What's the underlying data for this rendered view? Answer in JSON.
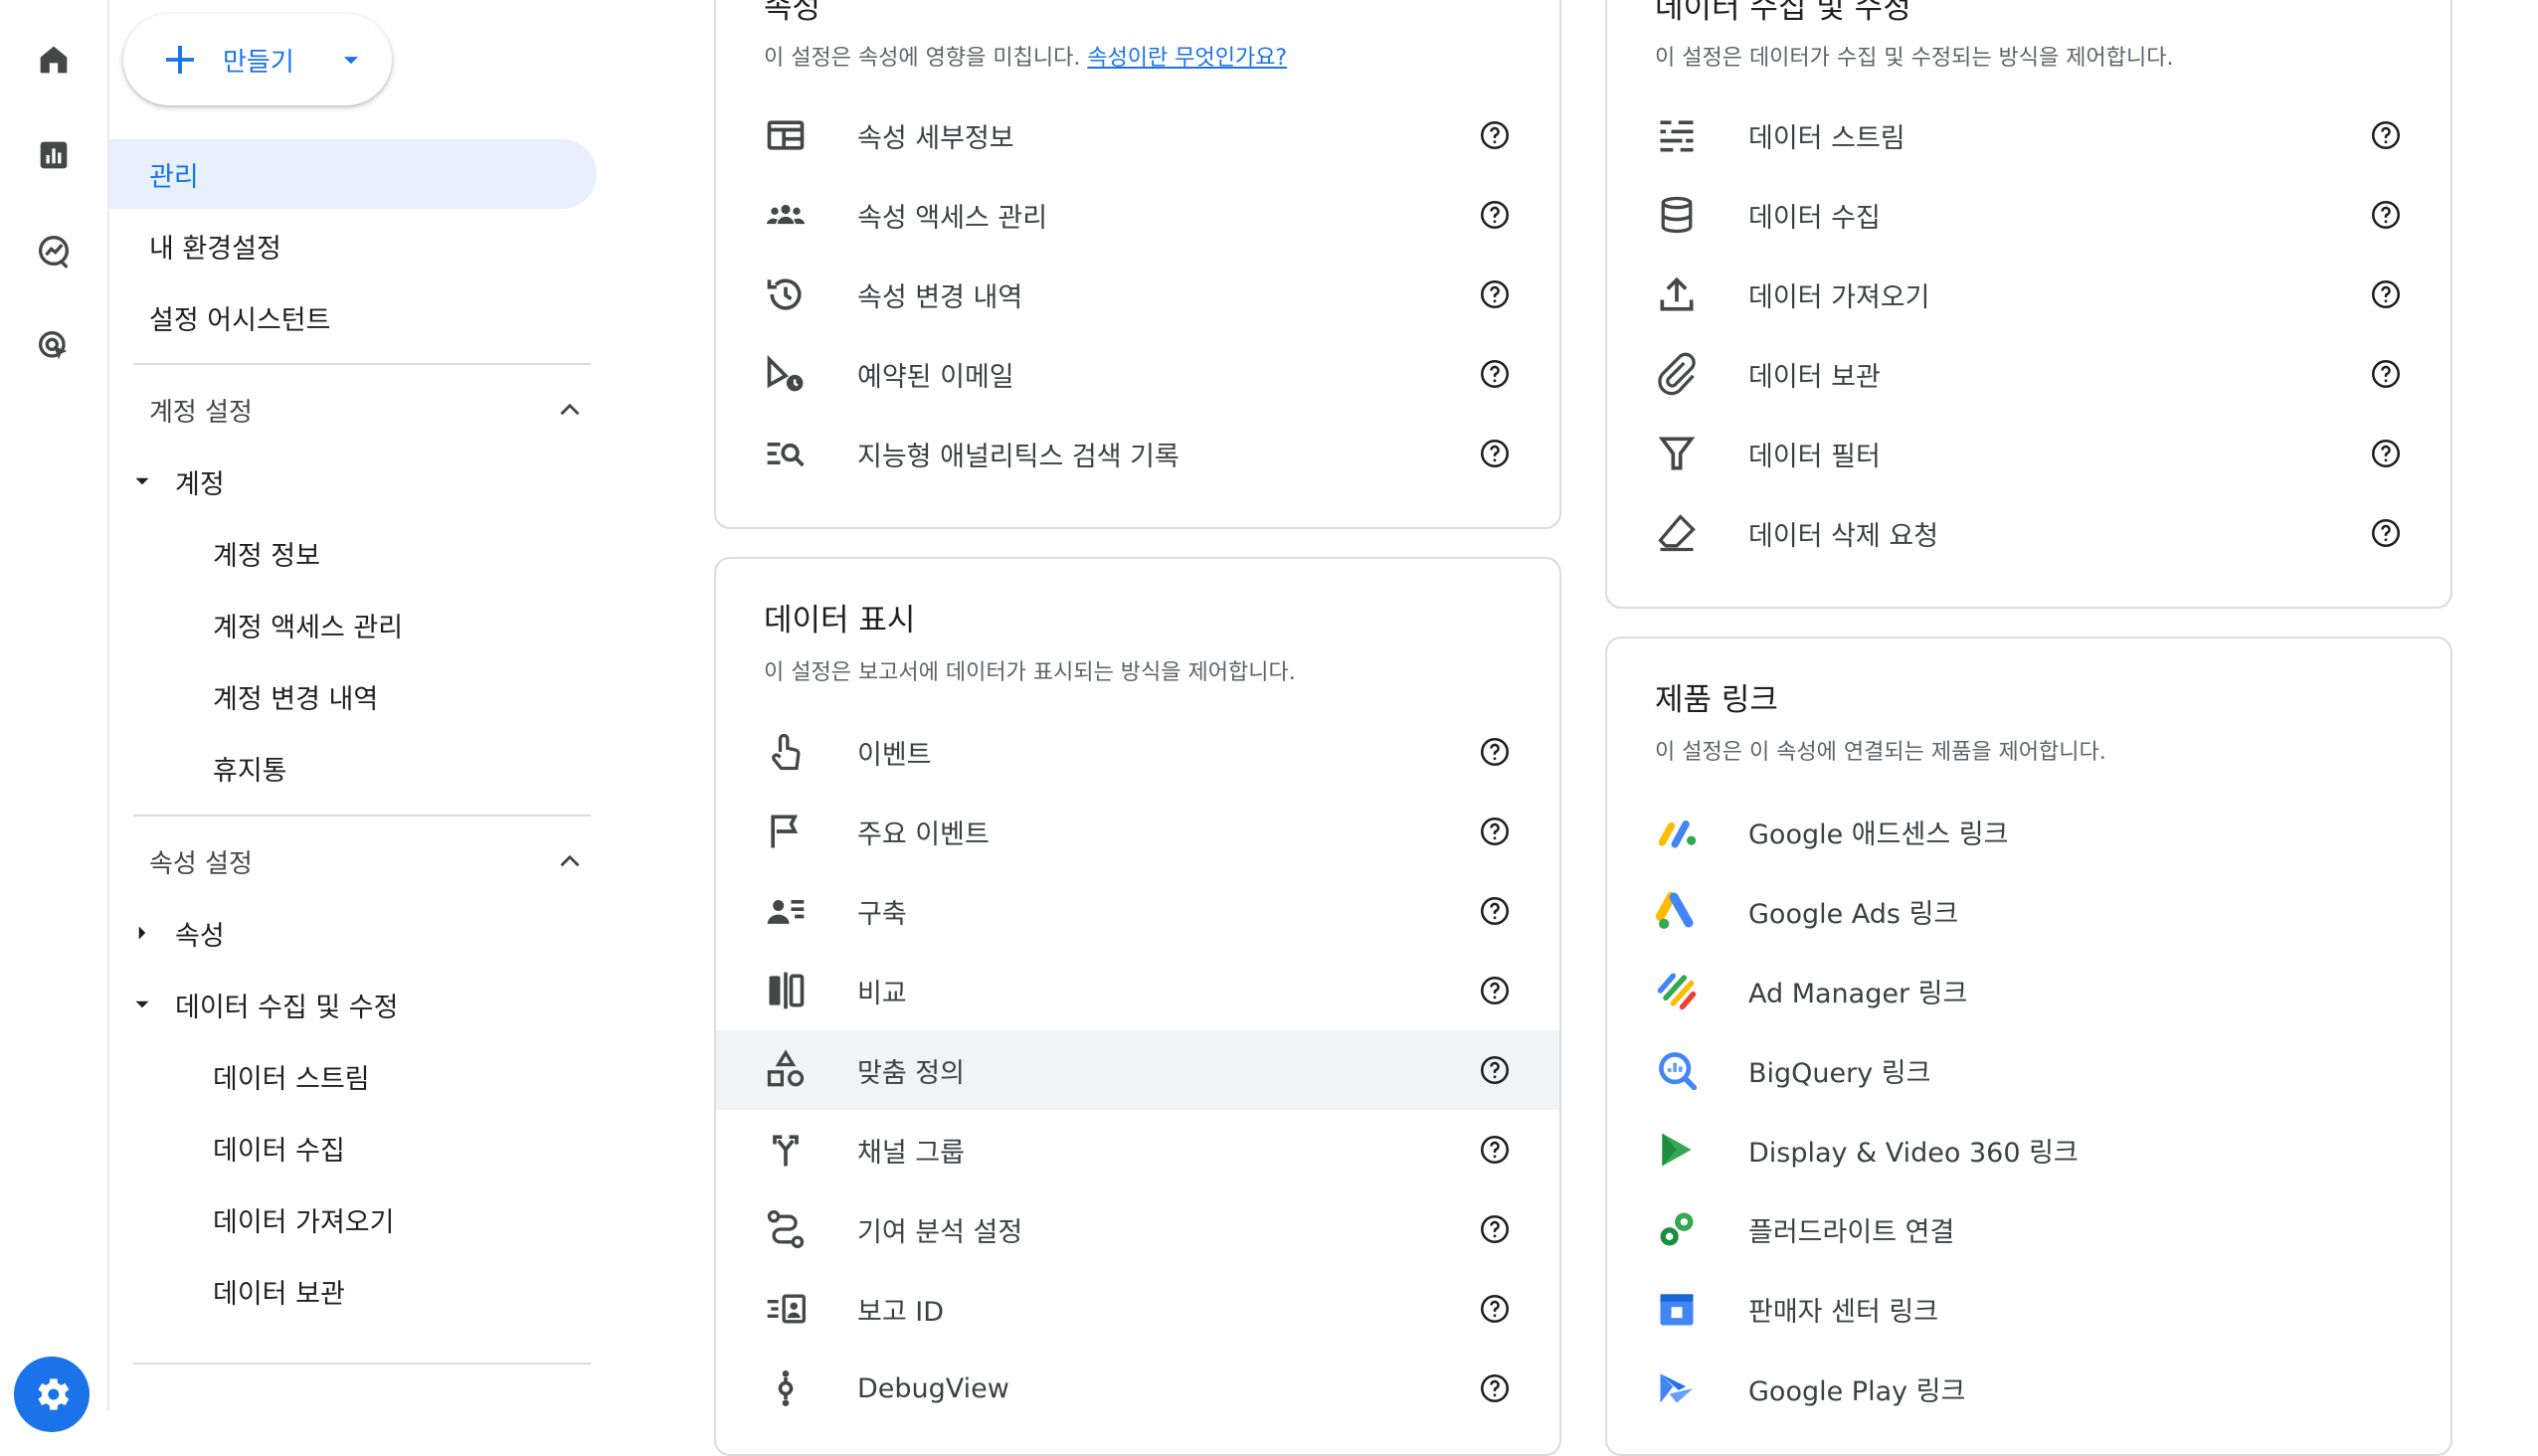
{
  "rail": {
    "items": [
      {
        "name": "home-icon"
      },
      {
        "name": "reports-icon"
      },
      {
        "name": "explore-icon"
      },
      {
        "name": "advertising-icon"
      }
    ],
    "settings_icon": "gear-icon"
  },
  "sidebar": {
    "create_label": "만들기",
    "top_items": [
      "관리",
      "내 환경설정",
      "설정 어시스턴트"
    ],
    "account_section": {
      "title": "계정 설정",
      "group": "계정",
      "children": [
        "계정 정보",
        "계정 액세스 관리",
        "계정 변경 내역",
        "휴지통"
      ]
    },
    "property_section": {
      "title": "속성 설정",
      "group_property": "속성",
      "group_data": "데이터 수집 및 수정",
      "children": [
        "데이터 스트림",
        "데이터 수집",
        "데이터 가져오기",
        "데이터 보관"
      ]
    }
  },
  "cards": {
    "property": {
      "title": "속성",
      "subtitle": "이 설정은 속성에 영향을 미칩니다.",
      "link": "속성이란 무엇인가요?",
      "rows": [
        "속성 세부정보",
        "속성 액세스 관리",
        "속성 변경 내역",
        "예약된 이메일",
        "지능형 애널리틱스 검색 기록"
      ]
    },
    "data_collection": {
      "title": "데이터 수집 및 수정",
      "subtitle": "이 설정은 데이터가 수집 및 수정되는 방식을 제어합니다.",
      "rows": [
        "데이터 스트림",
        "데이터 수집",
        "데이터 가져오기",
        "데이터 보관",
        "데이터 필터",
        "데이터 삭제 요청"
      ]
    },
    "data_display": {
      "title": "데이터 표시",
      "subtitle": "이 설정은 보고서에 데이터가 표시되는 방식을 제어합니다.",
      "rows": [
        "이벤트",
        "주요 이벤트",
        "구축",
        "비교",
        "맞춤 정의",
        "채널 그룹",
        "기여 분석 설정",
        "보고 ID",
        "DebugView"
      ]
    },
    "product_links": {
      "title": "제품 링크",
      "subtitle": "이 설정은 이 속성에 연결되는 제품을 제어합니다.",
      "rows": [
        "Google 애드센스 링크",
        "Google Ads 링크",
        "Ad Manager 링크",
        "BigQuery 링크",
        "Display & Video 360 링크",
        "플러드라이트 연결",
        "판매자 센터 링크",
        "Google Play 링크"
      ]
    }
  },
  "colors": {
    "accent": "#1a73e8",
    "active_bg": "#e8f0fe",
    "hover_bg": "#f1f3f4",
    "icon": "#444746"
  }
}
